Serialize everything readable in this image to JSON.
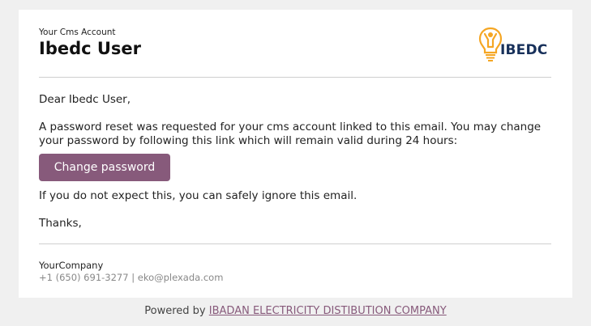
{
  "header": {
    "account_label": "Your Cms Account",
    "account_name": "Ibedc User",
    "logo_text": "IBEDC"
  },
  "body": {
    "greeting": "Dear Ibedc User,",
    "message": "A password reset was requested for your cms account linked to this email. You may change your password by following this link which will remain valid during 24 hours:",
    "button_label": "Change password",
    "ignore_note": "If you do not expect this, you can safely ignore this email.",
    "sign_off": "Thanks,"
  },
  "footer": {
    "company": "YourCompany",
    "phone": "+1 (650) 691-3277",
    "separator": "|",
    "email": "eko@plexada.com"
  },
  "powered_by": {
    "prefix": "Powered by",
    "link_text": "IBADAN ELECTRICITY DISTIBUTION COMPANY"
  },
  "colors": {
    "button": "#875a7b",
    "logo_bulb": "#f5a623",
    "logo_text": "#17305a",
    "background": "#f0f0f0"
  },
  "icons": {
    "logo": "lightbulb-person-icon"
  }
}
